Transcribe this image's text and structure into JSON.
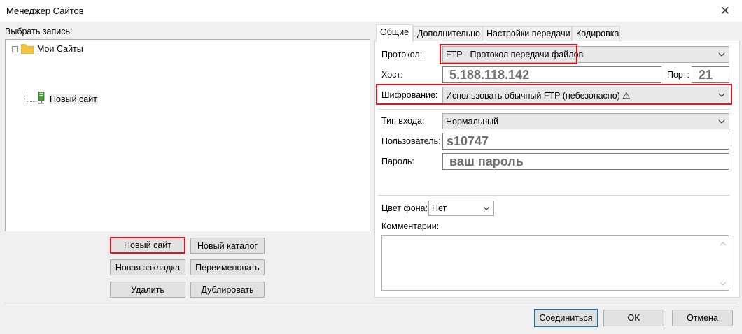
{
  "window": {
    "title": "Менеджер Сайтов",
    "close_glyph": "✕"
  },
  "left": {
    "select_label": "Выбрать запись:",
    "tree": {
      "root_label": "Мои Сайты",
      "child_label": "Новый сайт"
    },
    "buttons": {
      "new_site": "Новый сайт",
      "new_folder": "Новый каталог",
      "new_bookmark": "Новая закладка",
      "rename": "Переименовать",
      "delete": "Удалить",
      "duplicate": "Дублировать"
    }
  },
  "tabs": [
    "Общие",
    "Дополнительно",
    "Настройки передачи",
    "Кодировка"
  ],
  "general": {
    "protocol_label": "Протокол:",
    "protocol_value": "FTP - Протокол передачи файлов",
    "host_label": "Хост:",
    "host_value": "5.188.118.142",
    "port_label": "Порт:",
    "port_value": "21",
    "encryption_label": "Шифрование:",
    "encryption_value": "Использовать обычный FTP (небезопасно) ⚠",
    "logon_type_label": "Тип входа:",
    "logon_type_value": "Нормальный",
    "user_label": "Пользователь:",
    "user_value": "s10747",
    "password_label": "Пароль:",
    "password_value": "ваш пароль",
    "bg_color_label": "Цвет фона:",
    "bg_color_value": "Нет",
    "comments_label": "Комментарии:"
  },
  "footer": {
    "connect": "Соединиться",
    "ok": "OK",
    "cancel": "Отмена"
  },
  "colors": {
    "highlight": "#e0141e",
    "folder": "#f5c342",
    "server": "#4d9a3b"
  }
}
